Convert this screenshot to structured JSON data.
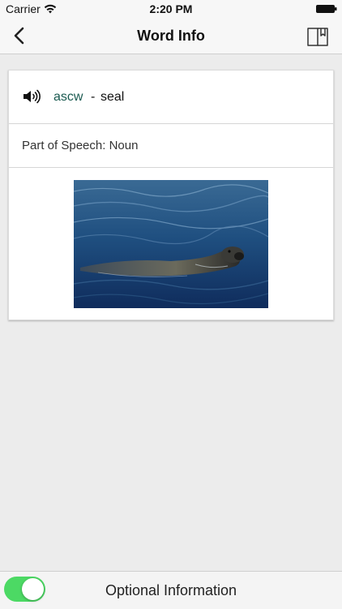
{
  "status_bar": {
    "carrier": "Carrier",
    "time": "2:20 PM"
  },
  "nav": {
    "title": "Word Info",
    "back_icon": "chevron-left-icon",
    "book_icon": "book-bookmark-icon"
  },
  "word": {
    "term": "ascw",
    "separator": "-",
    "translation": "seal",
    "part_of_speech": "Part of Speech: Noun",
    "speaker_icon": "speaker-icon"
  },
  "bottom": {
    "toggle_on": true,
    "label": "Optional Information"
  },
  "colors": {
    "term": "#1a5a50",
    "toggle_on": "#4cd964"
  }
}
